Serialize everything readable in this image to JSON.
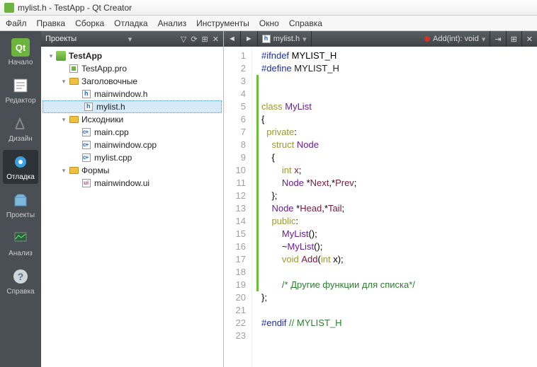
{
  "title": "mylist.h - TestApp - Qt Creator",
  "menu": [
    "Файл",
    "Правка",
    "Сборка",
    "Отладка",
    "Анализ",
    "Инструменты",
    "Окно",
    "Справка"
  ],
  "sidebar": [
    {
      "label": "Начало",
      "icon": "qt"
    },
    {
      "label": "Редактор",
      "icon": "editor"
    },
    {
      "label": "Дизайн",
      "icon": "design"
    },
    {
      "label": "Отладка",
      "icon": "debug"
    },
    {
      "label": "Проекты",
      "icon": "projects"
    },
    {
      "label": "Анализ",
      "icon": "analyze"
    },
    {
      "label": "Справка",
      "icon": "help"
    }
  ],
  "sidebar_selected": 3,
  "project_header": "Проекты",
  "tree": [
    {
      "indent": 0,
      "tw": "▾",
      "icon": "prj",
      "label": "TestApp",
      "bold": true
    },
    {
      "indent": 1,
      "tw": "",
      "icon": "pro",
      "label": "TestApp.pro"
    },
    {
      "indent": 1,
      "tw": "▾",
      "icon": "fld-h",
      "label": "Заголовочные"
    },
    {
      "indent": 2,
      "tw": "",
      "icon": "h",
      "label": "mainwindow.h"
    },
    {
      "indent": 2,
      "tw": "",
      "icon": "h",
      "label": "mylist.h",
      "sel": true
    },
    {
      "indent": 1,
      "tw": "▾",
      "icon": "fld",
      "label": "Исходники"
    },
    {
      "indent": 2,
      "tw": "",
      "icon": "cpp",
      "label": "main.cpp"
    },
    {
      "indent": 2,
      "tw": "",
      "icon": "cpp",
      "label": "mainwindow.cpp"
    },
    {
      "indent": 2,
      "tw": "",
      "icon": "cpp",
      "label": "mylist.cpp"
    },
    {
      "indent": 1,
      "tw": "▾",
      "icon": "fld",
      "label": "Формы"
    },
    {
      "indent": 2,
      "tw": "",
      "icon": "ui",
      "label": "mainwindow.ui"
    }
  ],
  "editor_file": "mylist.h",
  "editor_method": "Add(int): void",
  "code": [
    {
      "n": 1,
      "mod": false,
      "html": "<span class='kw-pre'>#ifndef</span> MYLIST_H"
    },
    {
      "n": 2,
      "mod": false,
      "html": "<span class='kw-pre'>#define</span> <span class='nm'>MYLIST_H</span>"
    },
    {
      "n": 3,
      "mod": true,
      "html": ""
    },
    {
      "n": 4,
      "mod": true,
      "html": ""
    },
    {
      "n": 5,
      "mod": true,
      "html": "<span class='kw'>class</span> <span class='typ'>MyList</span>"
    },
    {
      "n": 6,
      "mod": true,
      "html": "{"
    },
    {
      "n": 7,
      "mod": true,
      "html": "  <span class='kw'>private</span>:"
    },
    {
      "n": 8,
      "mod": true,
      "html": "    <span class='kw'>struct</span> <span class='typ'>Node</span>"
    },
    {
      "n": 9,
      "mod": true,
      "html": "    {"
    },
    {
      "n": 10,
      "mod": true,
      "html": "        <span class='kw'>int</span> <span class='fn'>x</span>;"
    },
    {
      "n": 11,
      "mod": true,
      "html": "        <span class='typ'>Node</span> *<span class='fn'>Next</span>,*<span class='fn'>Prev</span>;"
    },
    {
      "n": 12,
      "mod": true,
      "html": "    };"
    },
    {
      "n": 13,
      "mod": true,
      "html": "    <span class='typ'>Node</span> *<span class='fn'>Head</span>,*<span class='fn'>Tail</span>;"
    },
    {
      "n": 14,
      "mod": true,
      "html": "    <span class='kw'>public</span>:"
    },
    {
      "n": 15,
      "mod": true,
      "html": "        <span class='typ'>MyList</span>();"
    },
    {
      "n": 16,
      "mod": true,
      "html": "        ~<span class='typ'>MyList</span>();"
    },
    {
      "n": 17,
      "mod": true,
      "html": "        <span class='kw'>void</span> <span class='fn'>Add</span>(<span class='kw'>int</span> x);"
    },
    {
      "n": 18,
      "mod": true,
      "html": ""
    },
    {
      "n": 19,
      "mod": true,
      "html": "        <span class='cm'>/* Другие функции для списка*/</span>"
    },
    {
      "n": 20,
      "mod": false,
      "html": "};"
    },
    {
      "n": 21,
      "mod": false,
      "html": ""
    },
    {
      "n": 22,
      "mod": false,
      "html": "<span class='kw-pre'>#endif</span> <span class='cm'>// MYLIST_H</span>"
    },
    {
      "n": 23,
      "mod": false,
      "html": ""
    }
  ]
}
